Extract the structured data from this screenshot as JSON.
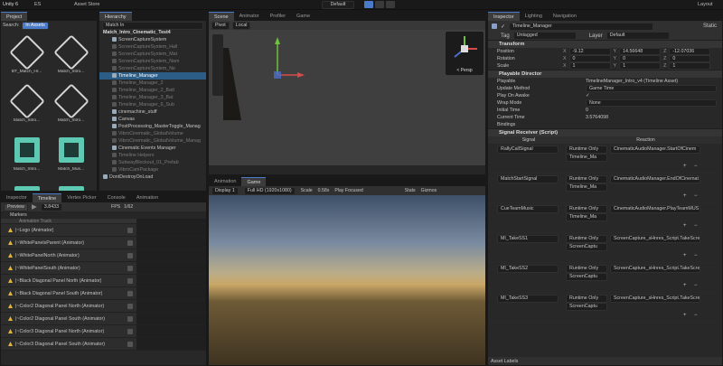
{
  "toolbar": {
    "account": "Unity 6",
    "cloud": "ES",
    "asset_store": "Asset Store",
    "layout_select": "Default",
    "layout_label": "Layout"
  },
  "project": {
    "tab": "Project",
    "search_label": "Search:",
    "search_scope": "In Assets",
    "items": [
      {
        "label": "BT_Match_Hr...",
        "kind": "unity"
      },
      {
        "label": "Match_Intro...",
        "kind": "unity"
      },
      {
        "label": "Match_Intro...",
        "kind": "unity"
      },
      {
        "label": "Match_Intro...",
        "kind": "unity"
      },
      {
        "label": "Match_Intro...",
        "kind": "film"
      },
      {
        "label": "Match_Mus...",
        "kind": "film"
      },
      {
        "label": "Match_Mus...",
        "kind": "film"
      },
      {
        "label": "Match_Mus...",
        "kind": "film"
      }
    ]
  },
  "hierarchy": {
    "tab": "Hierarchy",
    "search": "Match In",
    "scene": "Match_Intro_Cinematic_Test4",
    "items": [
      {
        "label": "ScreenCaptureSystem",
        "depth": 1,
        "state": "normal"
      },
      {
        "label": "ScreenCaptureSystem_Hall",
        "depth": 1,
        "state": "dim"
      },
      {
        "label": "ScreenCaptureSystem_Mat",
        "depth": 1,
        "state": "dim"
      },
      {
        "label": "ScreenCaptureSystem_Nam",
        "depth": 1,
        "state": "dim"
      },
      {
        "label": "ScreenCaptureSystem_Ne",
        "depth": 1,
        "state": "dim"
      },
      {
        "label": "Timeline_Manager",
        "depth": 1,
        "state": "selected"
      },
      {
        "label": "Timeline_Manager_2",
        "depth": 1,
        "state": "dim"
      },
      {
        "label": "Timeline_Manager_2_Batt",
        "depth": 1,
        "state": "dim"
      },
      {
        "label": "Timeline_Manager_3_Bat",
        "depth": 1,
        "state": "dim"
      },
      {
        "label": "Timeline_Manager_6_Sub",
        "depth": 1,
        "state": "dim"
      },
      {
        "label": "cinemachine_stuff",
        "depth": 1,
        "state": "normal"
      },
      {
        "label": "Canvas",
        "depth": 1,
        "state": "normal"
      },
      {
        "label": "PostProcessing_MasterToggle_Manag",
        "depth": 1,
        "state": "normal"
      },
      {
        "label": "VibroCinematic_GlobalVolume",
        "depth": 1,
        "state": "dim"
      },
      {
        "label": "VibroCinematic_GlobalVolume_Manag",
        "depth": 1,
        "state": "dim"
      },
      {
        "label": "Cinematic Events Manager",
        "depth": 1,
        "state": "normal"
      },
      {
        "label": "Timeline Helpers",
        "depth": 1,
        "state": "dim"
      },
      {
        "label": "SubwayBlockout_01_Prefab",
        "depth": 1,
        "state": "dim"
      },
      {
        "label": "VibroCamPackage",
        "depth": 1,
        "state": "dim"
      },
      {
        "label": "DontDestroyOnLoad",
        "depth": 0,
        "state": "normal"
      }
    ]
  },
  "scene": {
    "tabs": [
      "Scene",
      "Animator",
      "Profiler",
      "Game"
    ],
    "tool_pivot": "Pivot",
    "tool_local": "Local",
    "persp": "< Persp"
  },
  "game": {
    "tabs": [
      "Animation",
      "Game"
    ],
    "display": "Display 1",
    "resolution": "Full HD (1920x1080)",
    "scale_label": "Scale",
    "scale_value": "0.58x",
    "play_focused": "Play Focused",
    "stats": "Stats",
    "gizmos": "Gizmos"
  },
  "timeline": {
    "tabs": [
      "Inspector",
      "Timeline",
      "Vertex Picker",
      "Console",
      "Animation"
    ],
    "preview": "Preview",
    "frame": "3.8433",
    "fps": "FPS",
    "frame_total": "1/62",
    "markers": "Markers",
    "tracks": [
      {
        "label": "Animation Track"
      },
      {
        "label": "|~Logo (Animator)"
      },
      {
        "label": "|~WhitePanelsParent (Animator)"
      },
      {
        "label": "|~WhitePanelNorth (Animator)"
      },
      {
        "label": "|~WhitePanelSouth (Animator)"
      },
      {
        "label": "|~Black Diagonal Panel North (Animator)"
      },
      {
        "label": "|~Black Diagonal Panel South (Animator)"
      },
      {
        "label": "|~Color2 Diagonal Panel North (Animator)"
      },
      {
        "label": "|~Color2 Diagonal Panel South (Animator)"
      },
      {
        "label": "|~Color3 Diagonal Panel North (Animator)"
      },
      {
        "label": "|~Color3 Diagonal Panel South (Animator)"
      }
    ]
  },
  "inspector": {
    "tabs": [
      "Inspector",
      "Lighting",
      "Navigation"
    ],
    "object_name": "Timeline_Manager",
    "static": "Static",
    "tag_label": "Tag",
    "tag": "Untagged",
    "layer_label": "Layer",
    "layer": "Default",
    "transform": {
      "header": "Transform",
      "position_label": "Position",
      "rotation_label": "Rotation",
      "scale_label": "Scale",
      "position": {
        "x": "-9.12",
        "y": "14.56648",
        "z": "-12.07036"
      },
      "rotation": {
        "x": "0",
        "y": "0",
        "z": "0"
      },
      "scale": {
        "x": "1",
        "y": "1",
        "z": "1"
      }
    },
    "playable": {
      "header": "Playable Director",
      "rows": [
        {
          "label": "Playable",
          "value": "TimelineManager_Intro_v4 (Timeline Asset)"
        },
        {
          "label": "Update Method",
          "value": "Game Time"
        },
        {
          "label": "Play On Awake",
          "value": "✓"
        },
        {
          "label": "Wrap Mode",
          "value": "None"
        },
        {
          "label": "Initial Time",
          "value": "0"
        },
        {
          "label": "Current Time",
          "value": "3.5764098"
        }
      ],
      "bindings": "Bindings"
    },
    "signal": {
      "header": "Signal Receiver (Script)",
      "col_signal": "Signal",
      "col_reaction": "Reaction",
      "rows": [
        {
          "signal": "RallyCallSignal",
          "runtime": "Runtime Only",
          "target": "Timeline_Ma",
          "method": "CinematicAudioManager.StartOfCinem"
        },
        {
          "signal": "MatchStartSignal",
          "runtime": "Runtime Only",
          "target": "Timeline_Ma",
          "method": "CinematicAudioManager.EndOfCinemat"
        },
        {
          "signal": "CueTeamMusic",
          "runtime": "Runtime Only",
          "target": "Timeline_Ma",
          "method": "CinematicAudioManager.PlayTeamMUS"
        },
        {
          "signal": "MI_TakeSS1",
          "runtime": "Runtime Only",
          "target": "ScreenCaptu",
          "method": "ScreenCapture_sHnres_Script.TakeScree"
        },
        {
          "signal": "MI_TakeSS2",
          "runtime": "Runtime Only",
          "target": "ScreenCaptu",
          "method": "ScreenCapture_sHnres_Script.TakeScree"
        },
        {
          "signal": "MI_TakeSS3",
          "runtime": "Runtime Only",
          "target": "ScreenCaptu",
          "method": "ScreenCapture_sHnres_Script.TakeScree"
        }
      ]
    },
    "asset_labels": "Asset Labels"
  }
}
